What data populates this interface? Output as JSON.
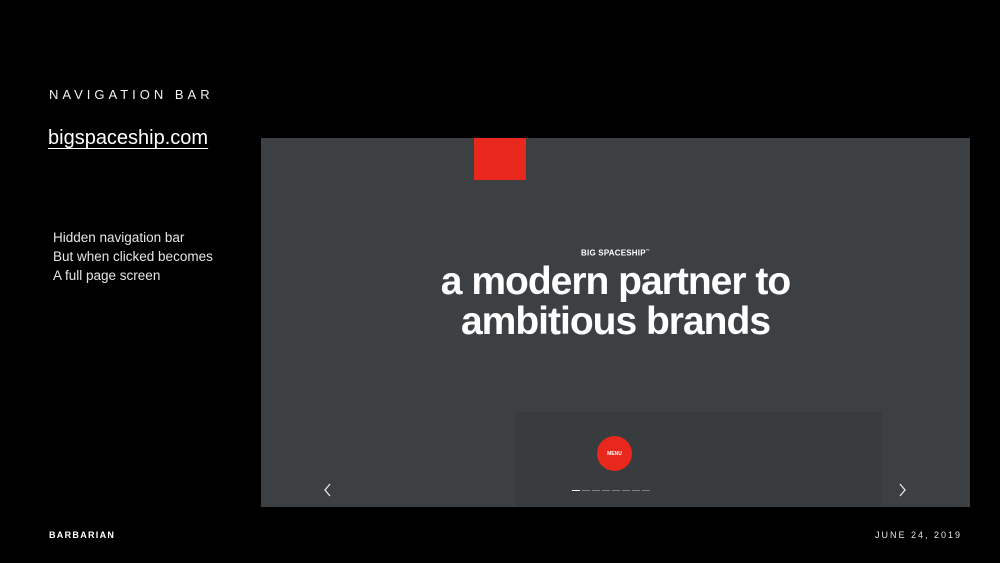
{
  "slide": {
    "heading": "NAVIGATION BAR",
    "site_link": "bigspaceship.com",
    "notes": [
      "Hidden navigation bar",
      "But when clicked becomes",
      "A full page screen"
    ]
  },
  "screenshot": {
    "logo": "BIG SPACESHIP",
    "headline": [
      "a modern partner to",
      "ambitious brands"
    ],
    "menu_label": "MENU",
    "pager": {
      "total": 8,
      "active": 1
    },
    "colors": {
      "background": "#3c4043",
      "accent": "#e8281c"
    },
    "icons": {
      "prev": "chevron-left-icon",
      "next": "chevron-right-icon"
    }
  },
  "footer": {
    "brand": "BARBARIAN",
    "date": "JUNE 24, 2019"
  }
}
